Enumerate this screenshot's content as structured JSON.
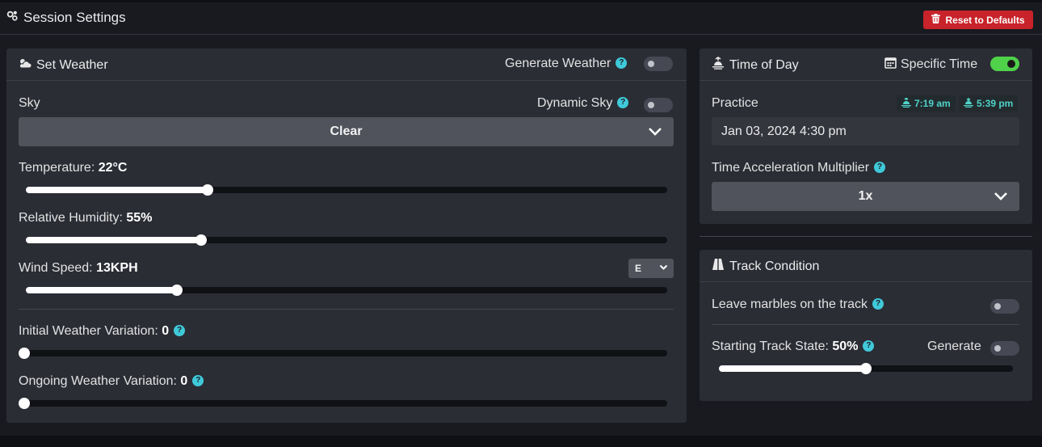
{
  "header": {
    "title": "Session Settings",
    "reset_label": "Reset to Defaults"
  },
  "weather": {
    "title": "Set Weather",
    "generate_label": "Generate Weather",
    "generate_on": false,
    "sky_label": "Sky",
    "dynamic_sky_label": "Dynamic Sky",
    "dynamic_sky_on": false,
    "sky_value": "Clear",
    "temperature": {
      "label": "Temperature:",
      "value": "22°C",
      "fraction": 0.283
    },
    "humidity": {
      "label": "Relative Humidity:",
      "value": "55%",
      "fraction": 0.273
    },
    "wind": {
      "label": "Wind Speed:",
      "value": "13KPH",
      "fraction": 0.236,
      "direction": "E"
    },
    "initial_variation": {
      "label": "Initial Weather Variation:",
      "value": "0",
      "fraction": 0
    },
    "ongoing_variation": {
      "label": "Ongoing Weather Variation:",
      "value": "0",
      "fraction": 0
    }
  },
  "time_of_day": {
    "title": "Time of Day",
    "specific_time_label": "Specific Time",
    "specific_time_on": true,
    "session_label": "Practice",
    "sunrise": "7:19 am",
    "sunset": "5:39 pm",
    "datetime": "Jan 03, 2024 4:30 pm",
    "accel_label": "Time Acceleration Multiplier",
    "accel_value": "1x"
  },
  "track": {
    "title": "Track Condition",
    "marbles_label": "Leave marbles on the track",
    "marbles_on": false,
    "state_label": "Starting Track State:",
    "state_value": "50%",
    "state_fraction": 0.5,
    "generate_label": "Generate",
    "generate_on": false
  },
  "help_glyph": "?",
  "colors": {
    "accent_teal": "#3fc9d9",
    "danger": "#c8232a",
    "toggle_on": "#4fd14a"
  }
}
